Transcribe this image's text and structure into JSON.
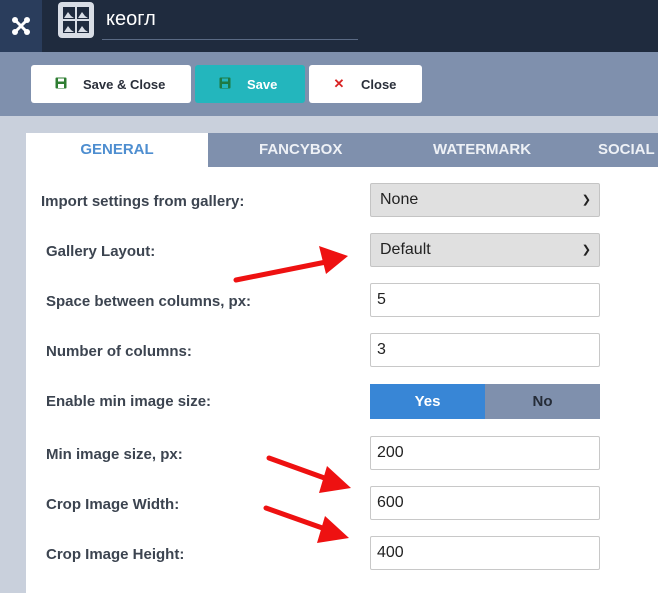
{
  "header": {
    "title_value": "кеогл",
    "logo_icon": "joomla-logo-icon",
    "title_icon": "gallery-icon"
  },
  "toolbar": {
    "save_close_label": "Save & Close",
    "save_label": "Save",
    "close_label": "Close"
  },
  "tabs": [
    {
      "label": "GENERAL",
      "active": true
    },
    {
      "label": "FANCYBOX",
      "active": false
    },
    {
      "label": "WATERMARK",
      "active": false
    },
    {
      "label": "SOCIAL",
      "active": false
    }
  ],
  "form": {
    "import_settings": {
      "label": "Import settings from gallery:",
      "value": "None"
    },
    "gallery_layout": {
      "label": "Gallery Layout:",
      "value": "Default"
    },
    "space_between_columns": {
      "label": "Space between columns, px:",
      "value": "5"
    },
    "number_of_columns": {
      "label": "Number of columns:",
      "value": "3"
    },
    "enable_min_image_size": {
      "label": "Enable min image size:",
      "yes": "Yes",
      "no": "No",
      "selected": "Yes"
    },
    "min_image_size": {
      "label": "Min image size, px:",
      "value": "200"
    },
    "crop_image_width": {
      "label": "Crop Image Width:",
      "value": "600"
    },
    "crop_image_height": {
      "label": "Crop Image Height:",
      "value": "400"
    }
  },
  "colors": {
    "header_bg": "#1f2b3e",
    "toolbar_bg": "#7f90ad",
    "save_button": "#23b6bd",
    "active_tab_text": "#4e8ed0",
    "toggle_yes": "#3886d6",
    "annotation_arrow": "#ee1111"
  }
}
